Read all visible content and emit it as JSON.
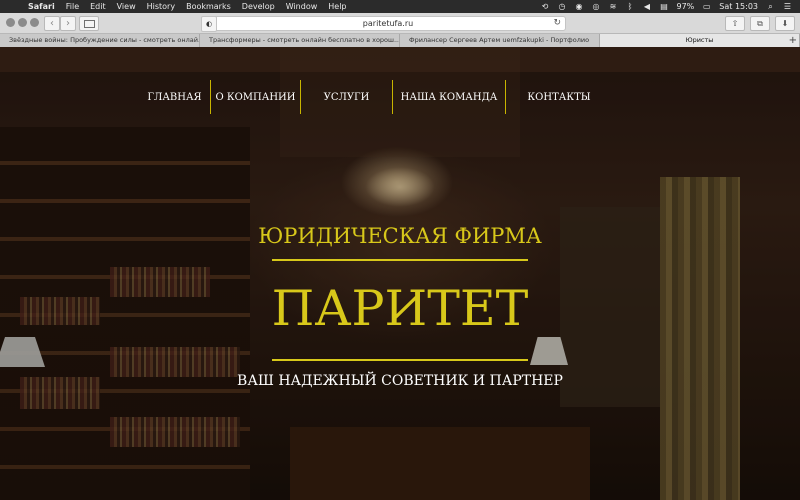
{
  "menubar": {
    "apple": "",
    "app": "Safari",
    "items": [
      "File",
      "Edit",
      "View",
      "History",
      "Bookmarks",
      "Develop",
      "Window",
      "Help"
    ],
    "battery": "97%",
    "clock": "Sat 15:03"
  },
  "toolbar": {
    "url": "paritetufa.ru"
  },
  "tabs": [
    {
      "title": "Звёздные войны: Пробуждение силы - смотреть онлай..."
    },
    {
      "title": "Трансформеры - смотреть онлайн бесплатно в хорош..."
    },
    {
      "title": "Фрилансер Сергеев Артем uemfzakupki - Портфолио"
    },
    {
      "title": "Юристы"
    }
  ],
  "nav": {
    "items": [
      "ГЛАВНАЯ",
      "О КОМПАНИИ",
      "УСЛУГИ",
      "НАША КОМАНДА",
      "КОНТАКТЫ"
    ]
  },
  "hero": {
    "subtitle": "ЮРИДИЧЕСКАЯ ФИРМА",
    "brand": "ПАРИТЕТ",
    "tagline": "ВАШ НАДЕЖНЫЙ СОВЕТНИК И ПАРТНЕР"
  },
  "colors": {
    "accent": "#d8c81a",
    "menubar": "#2b2b2b",
    "toolbar": "#d9d9d9",
    "tabbar": "#c9c9c9"
  }
}
